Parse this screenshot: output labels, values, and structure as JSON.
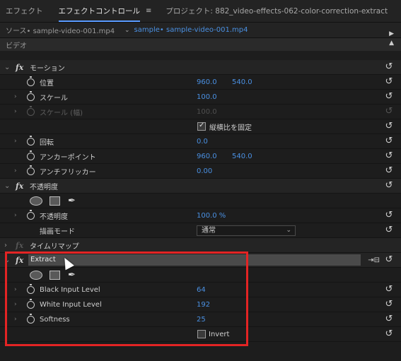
{
  "tabs": [
    {
      "label": "エフェクト",
      "active": false
    },
    {
      "label": "エフェクトコントロール",
      "active": true
    },
    {
      "label": "プロジェクト: 882_video-effects-062-color-correction-extract",
      "active": false
    }
  ],
  "tab_menu_icon": "hamburger-icon",
  "source": {
    "label": "ソース• sample-video-001.mp4",
    "sequence": "sample• sample-video-001.mp4"
  },
  "section_video": "ビデオ",
  "motion": {
    "title": "モーション",
    "position": {
      "label": "位置",
      "x": "960.0",
      "y": "540.0"
    },
    "scale": {
      "label": "スケール",
      "value": "100.0"
    },
    "scale_width": {
      "label": "スケール (幅)",
      "value": "100.0"
    },
    "uniform_scale": {
      "label": "縦横比を固定",
      "checked": true
    },
    "rotation": {
      "label": "回転",
      "value": "0.0"
    },
    "anchor": {
      "label": "アンカーポイント",
      "x": "960.0",
      "y": "540.0"
    },
    "antiflicker": {
      "label": "アンチフリッカー",
      "value": "0.00"
    }
  },
  "opacity": {
    "title": "不透明度",
    "opacity": {
      "label": "不透明度",
      "value": "100.0 %"
    },
    "blend": {
      "label": "描画モード",
      "value": "通常"
    }
  },
  "timeremap": {
    "title": "タイムリマップ"
  },
  "extract": {
    "title": "Extract",
    "black_input": {
      "label": "Black Input Level",
      "value": "64"
    },
    "white_input": {
      "label": "White Input Level",
      "value": "192"
    },
    "softness": {
      "label": "Softness",
      "value": "25"
    },
    "invert": {
      "label": "Invert",
      "checked": false
    }
  },
  "colors": {
    "accent": "#4a90e2",
    "highlight": "#e32424"
  }
}
